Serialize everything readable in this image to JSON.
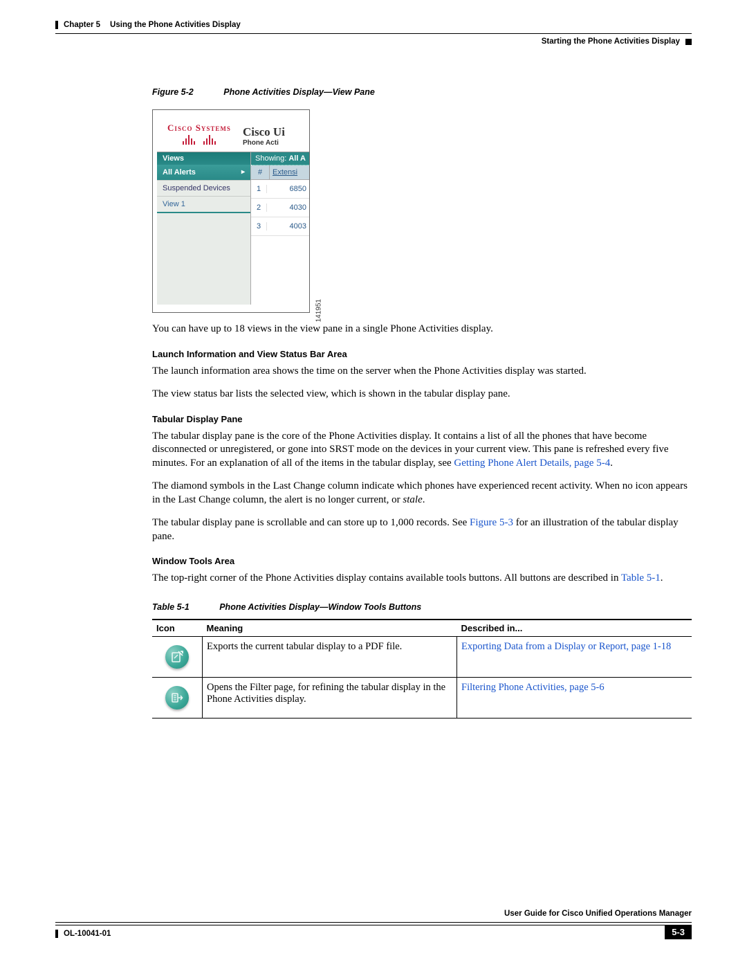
{
  "header": {
    "chapter_label": "Chapter 5",
    "chapter_title": "Using the Phone Activities Display",
    "section_title": "Starting the Phone Activities Display"
  },
  "figure": {
    "label": "Figure 5-2",
    "title": "Phone Activities Display—View Pane",
    "image_id": "141951",
    "logo_text": "Cisco Systems",
    "app_title": "Cisco Ui",
    "app_subtitle": "Phone Acti",
    "showing_prefix": "Showing: ",
    "showing_value": "All A",
    "views_header": "Views",
    "views": [
      "All Alerts",
      "Suspended Devices",
      "View 1"
    ],
    "table_headers": {
      "num": "#",
      "ext": "Extensi"
    },
    "rows": [
      {
        "n": "1",
        "ext": "6850"
      },
      {
        "n": "2",
        "ext": "4030"
      },
      {
        "n": "3",
        "ext": "4003"
      }
    ]
  },
  "para_after_fig": "You can have up to 18 views in the view pane in a single Phone Activities display.",
  "sec_launch": {
    "heading": "Launch Information and View Status Bar Area",
    "p1": "The launch information area shows the time on the server when the Phone Activities display was started.",
    "p2": "The view status bar lists the selected view, which is shown in the tabular display pane."
  },
  "sec_tabular": {
    "heading": "Tabular Display Pane",
    "p1_a": "The tabular display pane is the core of the Phone Activities display. It contains a list of all the phones that have become disconnected or unregistered, or gone into SRST mode on the devices in your current view. This pane is refreshed every five minutes. For an explanation of all of the items in the tabular display, see ",
    "p1_link": "Getting Phone Alert Details, page 5-4",
    "p1_b": ".",
    "p2_a": "The diamond symbols in the Last Change column indicate which phones have experienced recent activity. When no icon appears in the Last Change column, the alert is no longer current, or ",
    "p2_i": "stale",
    "p2_b": ".",
    "p3_a": "The tabular display pane is scrollable and can store up to 1,000 records. See ",
    "p3_link": "Figure 5-3",
    "p3_b": " for an illustration of the tabular display pane."
  },
  "sec_tools": {
    "heading": "Window Tools Area",
    "p1_a": "The top-right corner of the Phone Activities display contains available tools buttons. All buttons are described in ",
    "p1_link": "Table 5-1",
    "p1_b": "."
  },
  "table": {
    "label": "Table 5-1",
    "title": "Phone Activities Display—Window Tools Buttons",
    "headers": {
      "icon": "Icon",
      "meaning": "Meaning",
      "described": "Described in..."
    },
    "rows": [
      {
        "meaning": "Exports the current tabular display to a PDF file.",
        "link": "Exporting Data from a Display or Report, page 1-18"
      },
      {
        "meaning": "Opens the Filter page, for refining the tabular display in the Phone Activities display.",
        "link": "Filtering Phone Activities, page 5-6"
      }
    ]
  },
  "footer": {
    "guide_title": "User Guide for Cisco Unified Operations Manager",
    "doc_id": "OL-10041-01",
    "page_number": "5-3"
  }
}
